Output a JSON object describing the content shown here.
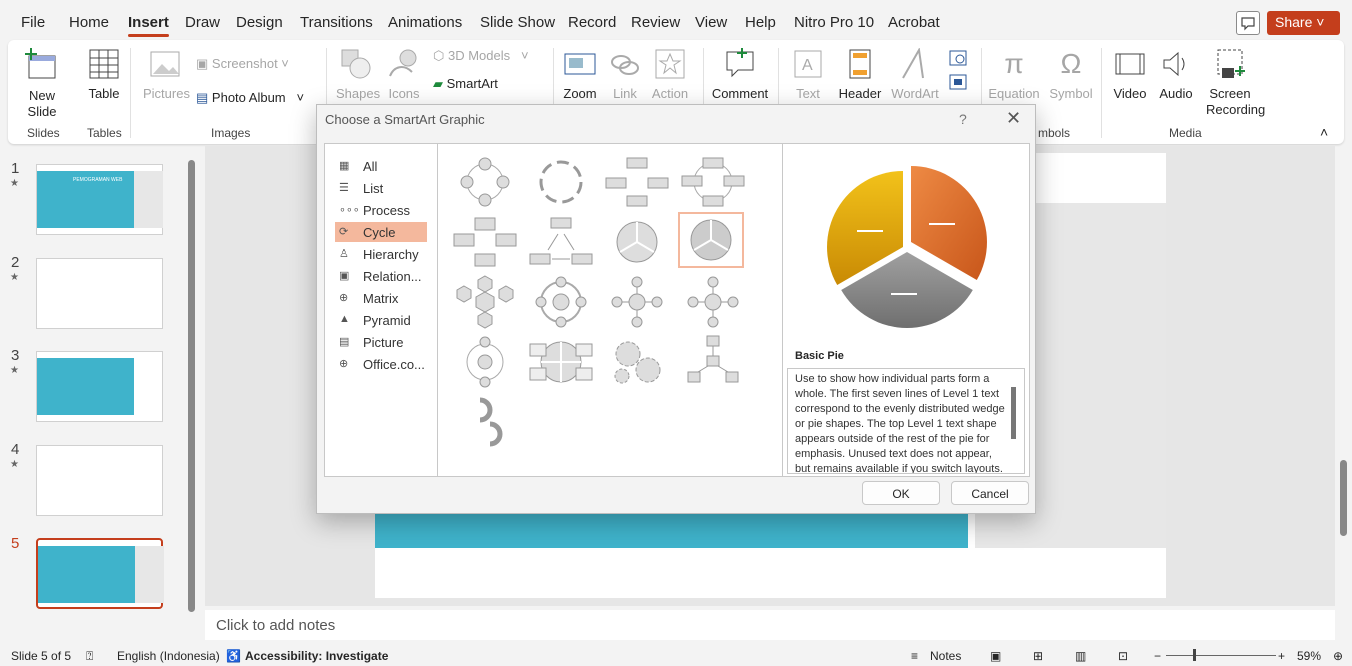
{
  "menu": {
    "tabs": [
      "File",
      "Home",
      "Insert",
      "Draw",
      "Design",
      "Transitions",
      "Animations",
      "Slide Show",
      "Record",
      "Review",
      "View",
      "Help",
      "Nitro Pro 10",
      "Acrobat"
    ],
    "active": "Insert",
    "share_label": "Share"
  },
  "ribbon": {
    "new_slide": "New Slide",
    "table": "Table",
    "pictures": "Pictures",
    "screenshot": "Screenshot",
    "photo_album": "Photo Album",
    "shapes": "Shapes",
    "icons": "Icons",
    "models": "3D Models",
    "smartart": "SmartArt",
    "zoom": "Zoom",
    "link": "Link",
    "action": "Action",
    "comment": "Comment",
    "text": "Text",
    "header": "Header",
    "wordart": "WordArt",
    "equation": "Equation",
    "symbol": "Symbol",
    "video": "Video",
    "audio": "Audio",
    "screen_recording": "Screen Recording",
    "groups": {
      "slides": "Slides",
      "tables": "Tables",
      "images": "Images",
      "symbols": "mbols",
      "media": "Media"
    }
  },
  "slides": {
    "numbers": [
      "1",
      "2",
      "3",
      "4",
      "5"
    ],
    "thumb1_title": "PEMOGRAMAN WEB"
  },
  "notes_placeholder": "Click to add notes",
  "status": {
    "slide": "Slide 5 of 5",
    "language": "English (Indonesia)",
    "accessibility": "Accessibility: Investigate",
    "notes": "Notes",
    "zoom": "59%"
  },
  "dialog": {
    "title": "Choose a SmartArt Graphic",
    "categories": [
      "All",
      "List",
      "Process",
      "Cycle",
      "Hierarchy",
      "Relation...",
      "Matrix",
      "Pyramid",
      "Picture",
      "Office.co..."
    ],
    "selected_category": "Cycle",
    "preview_title": "Basic Pie",
    "preview_description": "Use to show how individual parts form a whole. The first seven lines of Level 1 text correspond to the evenly distributed wedge or pie shapes. The top Level 1 text shape appears outside of the rest of the pie for emphasis. Unused text does not appear, but remains available if you switch layouts.",
    "ok": "OK",
    "cancel": "Cancel"
  },
  "colors": {
    "accent": "#c43e1c",
    "slide_band": "#3fb3cb",
    "selection": "#f4b89d",
    "pie_yellow": "#e0a90c",
    "pie_orange": "#e2742a",
    "pie_gray": "#8d8d8d"
  }
}
